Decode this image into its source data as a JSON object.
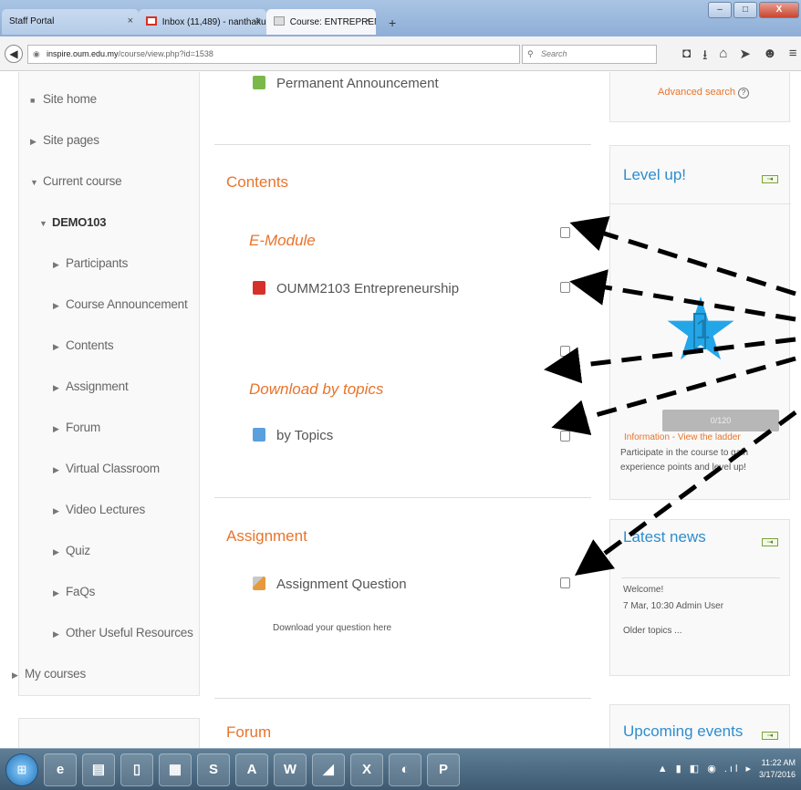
{
  "browser": {
    "tabs": [
      {
        "title": "Staff Portal",
        "close": "×",
        "active": false
      },
      {
        "title": "Inbox (11,489) - nanthaku...",
        "close": "×",
        "active": false
      },
      {
        "title": "Course: ENTREPRENEURSH...",
        "close": "×",
        "active": true
      }
    ],
    "new_tab": "+",
    "window_buttons": {
      "minimize": "–",
      "maximize": "□",
      "close": "X"
    },
    "url": "inspire.oum.edu.my/course/view.php?id=1538",
    "url_domain": "inspire.oum.edu.my",
    "url_path": "/course/view.php?id=1538",
    "search_placeholder": "Search"
  },
  "sidebar": {
    "items": [
      {
        "label": "Site home",
        "marker": "■"
      },
      {
        "label": "Site pages",
        "marker": "▶"
      },
      {
        "label": "Current course",
        "marker": "▼"
      },
      {
        "label": "DEMO103",
        "marker": "▼"
      },
      {
        "label": "Participants",
        "marker": "▶"
      },
      {
        "label": "Course Announcement",
        "marker": "▶"
      },
      {
        "label": "Contents",
        "marker": "▶"
      },
      {
        "label": "Assignment",
        "marker": "▶"
      },
      {
        "label": "Forum",
        "marker": "▶"
      },
      {
        "label": "Virtual Classroom",
        "marker": "▶"
      },
      {
        "label": "Video Lectures",
        "marker": "▶"
      },
      {
        "label": "Quiz",
        "marker": "▶"
      },
      {
        "label": "FaQs",
        "marker": "▶"
      },
      {
        "label": "Other Useful Resources",
        "marker": "▶"
      },
      {
        "label": "My courses",
        "marker": "▶"
      }
    ]
  },
  "main": {
    "permanent_announcement": "Permanent Announcement",
    "sections": [
      {
        "title": "Contents",
        "subsections": [
          {
            "title": "E-Module",
            "activities": [
              {
                "name": "OUMM2103 Entrepreneurship",
                "icon": "pdf-icon"
              }
            ]
          },
          {
            "title": "Download by topics",
            "activities": [
              {
                "name": "by Topics",
                "icon": "folder-icon"
              }
            ]
          }
        ]
      },
      {
        "title": "Assignment",
        "activities": [
          {
            "name": "Assignment Question",
            "icon": "assignment-icon",
            "description": "Download your question here"
          }
        ]
      },
      {
        "title": "Forum"
      }
    ]
  },
  "right": {
    "search": {
      "advanced_link": "Advanced search",
      "help": "?"
    },
    "level_up": {
      "title": "Level up!",
      "level": "1",
      "progress_text": "0/120",
      "text": "Participate in the course to gain experience points and level up!",
      "info_link": "Information",
      "separator": " - ",
      "ladder_link": "View the ladder"
    },
    "latest_news": {
      "title": "Latest news",
      "item_title": "Welcome!",
      "item_meta": "7 Mar, 10:30 Admin User",
      "older": "Older topics ..."
    },
    "upcoming": {
      "title": "Upcoming events"
    }
  },
  "taskbar": {
    "apps": [
      "e",
      "▤",
      "▯",
      "▦",
      "S",
      "A",
      "W",
      "◢",
      "X",
      "◐",
      "P"
    ],
    "tray": "▲ ▮ ◧ ◉ .ıl ▸",
    "time": "11:22 AM",
    "date": "3/17/2016"
  },
  "colors": {
    "accent_orange": "#e8742c",
    "accent_blue": "#2f8dce",
    "arrow": "#000000"
  }
}
